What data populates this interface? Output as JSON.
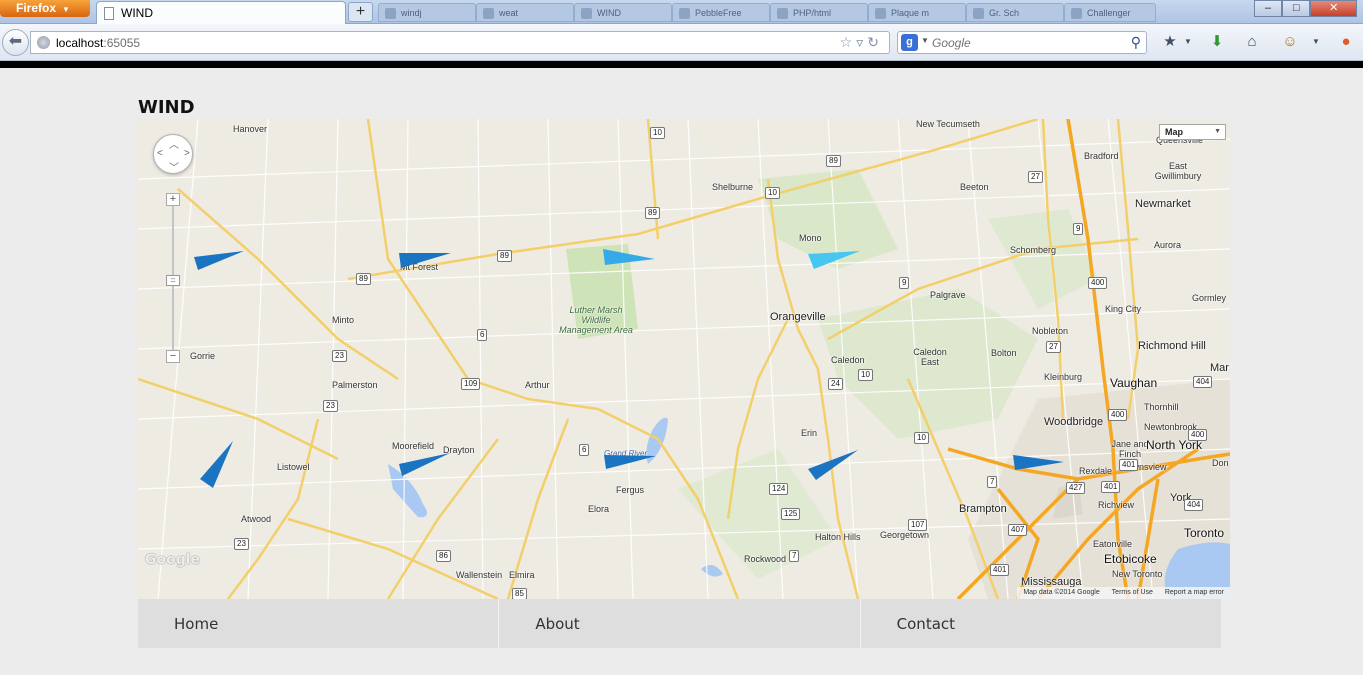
{
  "browser": {
    "menu_button": "Firefox",
    "active_tab_title": "WIND",
    "new_tab_symbol": "+",
    "background_tabs": [
      "windj",
      "weat",
      "WIND",
      "PebbleFree",
      "PHP/html",
      "Plaque m",
      "Gr. Sch",
      "Challenger"
    ],
    "url_host": "localhost",
    "url_port": ":65055",
    "search_placeholder": "Google",
    "window_controls": {
      "minimize": "–",
      "maximize": "□",
      "close": "✕"
    }
  },
  "page": {
    "title": "WIND"
  },
  "map": {
    "type_selector": "Map",
    "logo": "Google",
    "attribution": {
      "data": "Map data ©2014 Google",
      "terms": "Terms of Use",
      "report": "Report a map error"
    },
    "zoom_in": "+",
    "zoom_out": "−",
    "places": {
      "hanover": "Hanover",
      "new_tecumseth": "New Tecumseth",
      "bradford": "Bradford",
      "queensville": "Queensville",
      "east_gwillimbury": "East Gwillimbury",
      "shelburne": "Shelburne",
      "beeton": "Beeton",
      "newmarket": "Newmarket",
      "mono": "Mono",
      "schomberg": "Schomberg",
      "aurora": "Aurora",
      "mount_forest": "Mt Forest",
      "palgrave": "Palgrave",
      "gormley": "Gormley",
      "king_city": "King City",
      "minto": "Minto",
      "orangeville": "Orangeville",
      "nobleton": "Nobleton",
      "luther_marsh": "Luther Marsh Wildlife Management Area",
      "gorrie": "Gorrie",
      "caledon": "Caledon",
      "caledon_east": "Caledon East",
      "bolton": "Bolton",
      "richmond_hill": "Richmond Hill",
      "palmerston": "Palmerston",
      "arthur": "Arthur",
      "kleinburg": "Kleinburg",
      "vaughan": "Vaughan",
      "thornhill": "Thornhill",
      "woodbridge": "Woodbridge",
      "newtonbrook": "Newtonbrook",
      "moorefield": "Moorefield",
      "drayton": "Drayton",
      "erin": "Erin",
      "jane_and_finch": "Jane and Finch",
      "north_york": "North York",
      "grand_river": "Grand River",
      "listowel": "Listowel",
      "fergus": "Fergus",
      "rexdale": "Rexdale",
      "downsview": "Downsview",
      "elora": "Elora",
      "richview": "Richview",
      "york": "York",
      "brampton": "Brampton",
      "atwood": "Atwood",
      "halton_hills": "Halton Hills",
      "georgetown": "Georgetown",
      "toronto": "Toronto",
      "eatonville": "Eatonville",
      "etobicoke": "Etobicoke",
      "rockwood": "Rockwood",
      "new_toronto": "New Toronto",
      "wallenstein": "Wallenstein",
      "elmira": "Elmira",
      "mississauga": "Mississauga",
      "don": "Don",
      "mar": "Mar"
    },
    "shields": [
      "10",
      "89",
      "89",
      "10",
      "89",
      "9",
      "27",
      "9",
      "400",
      "89",
      "6",
      "23",
      "109",
      "24",
      "10",
      "27",
      "23",
      "400",
      "404",
      "6",
      "10",
      "407",
      "427",
      "401",
      "7",
      "124",
      "125",
      "107",
      "401",
      "23",
      "86",
      "7",
      "85",
      "401",
      "400",
      "404"
    ],
    "colors": {
      "land": "#eeebe3",
      "highway": "#f5a623",
      "major_road": "#f3cf6b",
      "water": "#a9c9f2",
      "park": "#c8dfb0",
      "urban": "#e4e0d6"
    },
    "wind_markers": [
      {
        "name": "wind-marker-hanover-south",
        "color": "#1a74c2"
      },
      {
        "name": "wind-marker-mount-forest",
        "color": "#1a74c2"
      },
      {
        "name": "wind-marker-luther-marsh",
        "color": "#36a9e8"
      },
      {
        "name": "wind-marker-mono",
        "color": "#47c6f2"
      },
      {
        "name": "wind-marker-listowel",
        "color": "#1a74c2"
      },
      {
        "name": "wind-marker-drayton",
        "color": "#1a74c2"
      },
      {
        "name": "wind-marker-fergus",
        "color": "#1a74c2"
      },
      {
        "name": "wind-marker-erin",
        "color": "#1a74c2"
      },
      {
        "name": "wind-marker-brampton",
        "color": "#1a74c2"
      }
    ]
  },
  "footer_nav": {
    "home": "Home",
    "about": "About",
    "contact": "Contact"
  }
}
